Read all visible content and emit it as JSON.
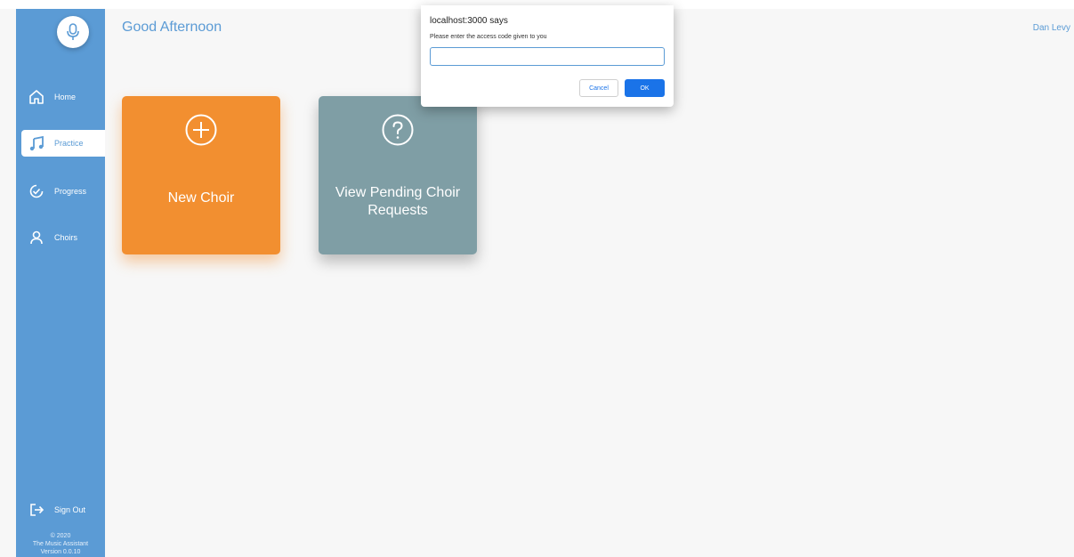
{
  "header": {
    "greeting": "Good Afternoon",
    "user_name": "Dan Levy"
  },
  "sidebar": {
    "logo_icon": "microphone-icon",
    "items": [
      {
        "label": "Home",
        "icon": "home-icon",
        "active": false
      },
      {
        "label": "Practice",
        "icon": "music-note-icon",
        "active": true
      },
      {
        "label": "Progress",
        "icon": "check-circle-icon",
        "active": false
      },
      {
        "label": "Choirs",
        "icon": "person-icon",
        "active": false
      }
    ],
    "sign_out": {
      "label": "Sign Out",
      "icon": "sign-out-icon"
    },
    "footer": {
      "copyright": "© 2020",
      "app_name": "The Music Assistant",
      "version": "Version 0.0.10"
    }
  },
  "cards": [
    {
      "label": "New Choir",
      "icon": "plus-circle-icon",
      "color": "#f28f30"
    },
    {
      "label": "View Pending Choir Requests",
      "icon": "question-circle-icon",
      "color": "#7f9ea5"
    }
  ],
  "dialog": {
    "title": "localhost:3000 says",
    "message": "Please enter the access code given to you",
    "input_value": "",
    "cancel_label": "Cancel",
    "ok_label": "OK"
  },
  "colors": {
    "accent": "#5b9bd5",
    "button_primary": "#1a73e8"
  }
}
